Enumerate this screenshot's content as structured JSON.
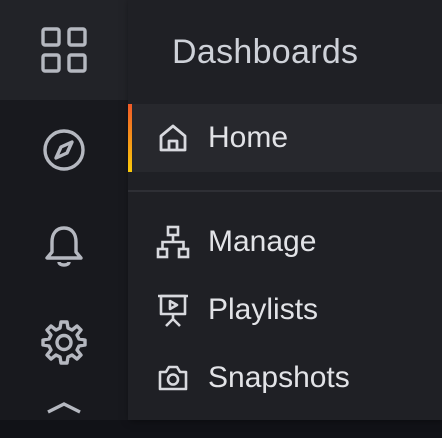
{
  "sidebar": {
    "icons": [
      {
        "name": "dashboards-icon",
        "active": true
      },
      {
        "name": "explore-icon",
        "active": false
      },
      {
        "name": "alerting-icon",
        "active": false
      },
      {
        "name": "configuration-icon",
        "active": false
      },
      {
        "name": "shield-icon",
        "active": false
      }
    ]
  },
  "flyout": {
    "title": "Dashboards",
    "items": [
      {
        "label": "Home",
        "icon": "home-icon",
        "active": true
      },
      {
        "label": "Manage",
        "icon": "sitemap-icon",
        "active": false
      },
      {
        "label": "Playlists",
        "icon": "presentation-play-icon",
        "active": false
      },
      {
        "label": "Snapshots",
        "icon": "camera-icon",
        "active": false
      }
    ]
  },
  "colors": {
    "accent_top": "#f05a28",
    "accent_bottom": "#fbca0a"
  }
}
